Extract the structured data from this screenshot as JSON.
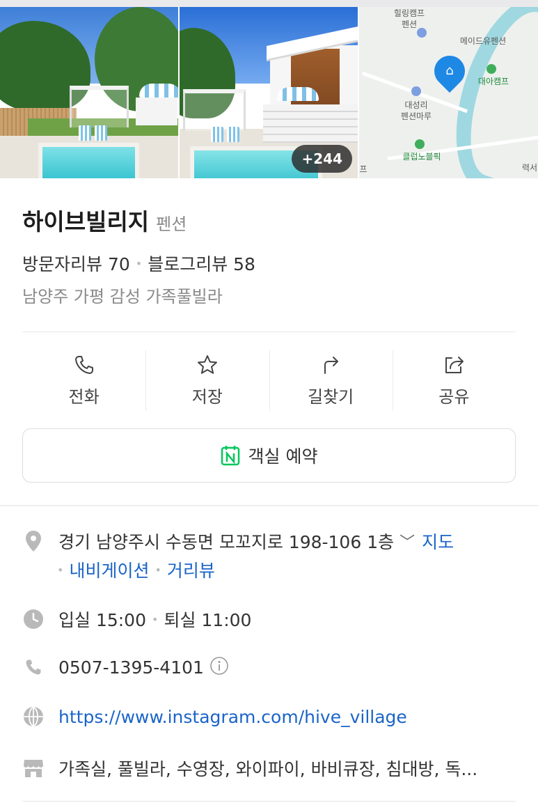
{
  "gallery": {
    "photo_count_badge": "+244",
    "map_labels": {
      "healing_camp": "힐링캠프",
      "healing_camp_2": "펜션",
      "madeyou": "메이드유펜션",
      "daea_camp": "대아캠프",
      "daeseongri": "대성리",
      "daeseongri_2": "펜션마루",
      "club_noblepic": "클럽노블픽",
      "edge_text": "력서",
      "edge_text_left": "프"
    }
  },
  "place": {
    "name": "하이브빌리지",
    "category": "펜션",
    "visitor_reviews": "방문자리뷰 70",
    "blog_reviews": "블로그리뷰 58",
    "description": "남양주 가평 감성 가족풀빌라"
  },
  "actions": [
    {
      "label": "전화",
      "icon": "phone-icon"
    },
    {
      "label": "저장",
      "icon": "star-icon"
    },
    {
      "label": "길찾기",
      "icon": "directions-icon"
    },
    {
      "label": "공유",
      "icon": "share-icon"
    }
  ],
  "booking": {
    "label": "객실 예약",
    "icon": "naver-calendar-icon",
    "accent": "#03c75a"
  },
  "info": {
    "address": "경기 남양주시 수동면 모꼬지로 198-106 1층",
    "map_link": "지도",
    "navigation_link": "내비게이션",
    "streetview_link": "거리뷰",
    "hours": "입실 15:00",
    "hours_2": "퇴실 11:00",
    "phone": "0507-1395-4101",
    "website": "https://www.instagram.com/hive_village",
    "amenities": "가족실, 풀빌라, 수영장, 와이파이, 바비큐장, 침대방, 독..."
  },
  "colors": {
    "link": "#1a64c8",
    "icon_gray": "#b9b9b9",
    "map_pin": "#1e88e5"
  }
}
